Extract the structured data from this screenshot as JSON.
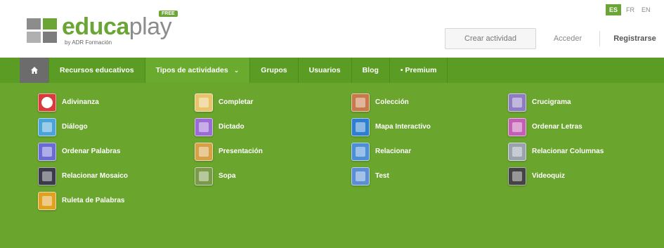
{
  "header": {
    "logo": {
      "word_edu": "educa",
      "word_play": "play",
      "badge": "FREE",
      "subtitle": "by ADR Formación"
    },
    "languages": [
      {
        "code": "ES",
        "active": true
      },
      {
        "code": "FR",
        "active": false
      },
      {
        "code": "EN",
        "active": false
      }
    ],
    "create_button": "Crear actividad",
    "login_link": "Acceder",
    "register_link": "Registrarse"
  },
  "nav": {
    "home_icon": "home-icon",
    "items": [
      {
        "label": "Recursos educativos",
        "active": false
      },
      {
        "label": "Tipos de actividades",
        "active": true,
        "caret": "⌄"
      },
      {
        "label": "Grupos",
        "active": false
      },
      {
        "label": "Usuarios",
        "active": false
      },
      {
        "label": "Blog",
        "active": false
      },
      {
        "label": "• Premium",
        "active": false
      }
    ]
  },
  "colors": {
    "brand_green": "#6aa535",
    "nav_green": "#5b9c25",
    "panel_green": "#6aa52d",
    "home_gray": "#6c6c6c"
  },
  "activities": [
    {
      "label": "Adivinanza",
      "icon": "riddle-icon",
      "color": "#d93b3b"
    },
    {
      "label": "Completar",
      "icon": "complete-icon",
      "color": "#e8c36a"
    },
    {
      "label": "Colección",
      "icon": "collection-icon",
      "color": "#c8794a"
    },
    {
      "label": "Crucigrama",
      "icon": "crossword-icon",
      "color": "#8e7cc3"
    },
    {
      "label": "Diálogo",
      "icon": "dialogue-icon",
      "color": "#4aa3d9"
    },
    {
      "label": "Dictado",
      "icon": "dictation-icon",
      "color": "#9b6bd6"
    },
    {
      "label": "Mapa Interactivo",
      "icon": "interactive-map-icon",
      "color": "#2f7fd1"
    },
    {
      "label": "Ordenar Letras",
      "icon": "order-letters-icon",
      "color": "#c35fb4"
    },
    {
      "label": "Ordenar Palabras",
      "icon": "order-words-icon",
      "color": "#6b6bd6"
    },
    {
      "label": "Presentación",
      "icon": "presentation-icon",
      "color": "#d7a046"
    },
    {
      "label": "Relacionar",
      "icon": "match-icon",
      "color": "#4c8fd6"
    },
    {
      "label": "Relacionar Columnas",
      "icon": "match-columns-icon",
      "color": "#9aa2ad"
    },
    {
      "label": "Relacionar Mosaico",
      "icon": "match-mosaic-icon",
      "color": "#3a3a4a"
    },
    {
      "label": "Sopa",
      "icon": "word-search-icon",
      "color": "#7a9a4a"
    },
    {
      "label": "Test",
      "icon": "test-icon",
      "color": "#5a8fd6"
    },
    {
      "label": "Videoquiz",
      "icon": "videoquiz-icon",
      "color": "#444444"
    },
    {
      "label": "Ruleta de Palabras",
      "icon": "word-roulette-icon",
      "color": "#e0a020"
    }
  ]
}
